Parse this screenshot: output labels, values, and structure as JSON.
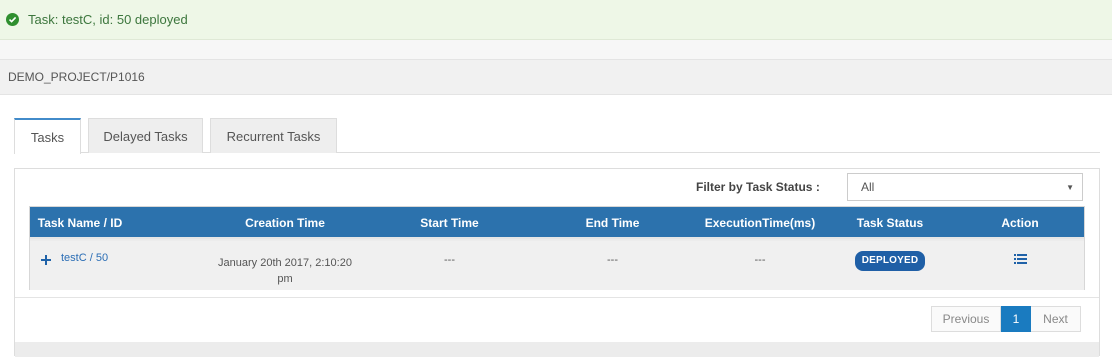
{
  "alert": {
    "message": "Task: testC, id: 50 deployed",
    "icon": "check-circle-icon",
    "color": "#3c763d"
  },
  "breadcrumb": "DEMO_PROJECT/P1016",
  "tabs": [
    {
      "label": "Tasks",
      "active": true
    },
    {
      "label": "Delayed Tasks",
      "active": false
    },
    {
      "label": "Recurrent Tasks",
      "active": false
    }
  ],
  "filter": {
    "label": "Filter by Task Status :",
    "value": "All",
    "caret": "▼"
  },
  "table": {
    "headers": [
      "Task Name / ID",
      "Creation Time",
      "Start Time",
      "End Time",
      "ExecutionTime(ms)",
      "Task Status",
      "Action"
    ],
    "rows": [
      {
        "task": "testC / 50",
        "creation_line1": "January 20th 2017, 2:10:20",
        "creation_line2": "pm",
        "start": "---",
        "end": "---",
        "execution": "---",
        "status": "DEPLOYED",
        "action_icon": "list-icon"
      }
    ]
  },
  "pagination": {
    "previous": "Previous",
    "current": "1",
    "next": "Next"
  },
  "colors": {
    "header_bg": "#2c72ad",
    "accent": "#1a7bc0",
    "badge_bg": "#1f5fa6"
  }
}
